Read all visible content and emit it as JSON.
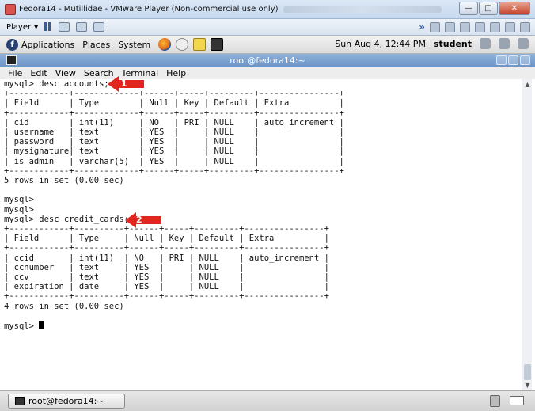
{
  "vm": {
    "title": "Fedora14 - Mutillidae - VMware Player (Non-commercial use only)",
    "player_menu": "Player",
    "toolbar_icons": [
      "pause-icon",
      "send-keys-icon",
      "fullscreen-icon",
      "unity-icon"
    ],
    "device_icons": [
      "network-icon",
      "cd-icon",
      "floppy-icon",
      "usb-icon",
      "printer-icon",
      "sound-icon",
      "display-icon"
    ]
  },
  "gnome": {
    "menus": [
      "Applications",
      "Places",
      "System"
    ],
    "clock": "Sun Aug  4, 12:44 PM",
    "user": "student"
  },
  "terminal": {
    "title": "root@fedora14:~",
    "menus": [
      "File",
      "Edit",
      "View",
      "Search",
      "Terminal",
      "Help"
    ],
    "lines": [
      "mysql> desc accounts;",
      "+------------+-------------+------+-----+---------+----------------+",
      "| Field      | Type        | Null | Key | Default | Extra          |",
      "+------------+-------------+------+-----+---------+----------------+",
      "| cid        | int(11)     | NO   | PRI | NULL    | auto_increment |",
      "| username   | text        | YES  |     | NULL    |                |",
      "| password   | text        | YES  |     | NULL    |                |",
      "| mysignature| text        | YES  |     | NULL    |                |",
      "| is_admin   | varchar(5)  | YES  |     | NULL    |                |",
      "+------------+-------------+------+-----+---------+----------------+",
      "5 rows in set (0.00 sec)",
      "",
      "mysql>",
      "mysql>",
      "mysql> desc credit_cards;",
      "+------------+----------+------+-----+---------+----------------+",
      "| Field      | Type     | Null | Key | Default | Extra          |",
      "+------------+----------+------+-----+---------+----------------+",
      "| ccid       | int(11)  | NO   | PRI | NULL    | auto_increment |",
      "| ccnumber   | text     | YES  |     | NULL    |                |",
      "| ccv        | text     | YES  |     | NULL    |                |",
      "| expiration | date     | YES  |     | NULL    |                |",
      "+------------+----------+------+-----+---------+----------------+",
      "4 rows in set (0.00 sec)",
      "",
      "mysql> "
    ]
  },
  "annotations": [
    {
      "label": "1",
      "color": "#e0261f"
    },
    {
      "label": "2",
      "color": "#e0261f"
    }
  ],
  "taskbar": {
    "task_label": "root@fedora14:~"
  }
}
